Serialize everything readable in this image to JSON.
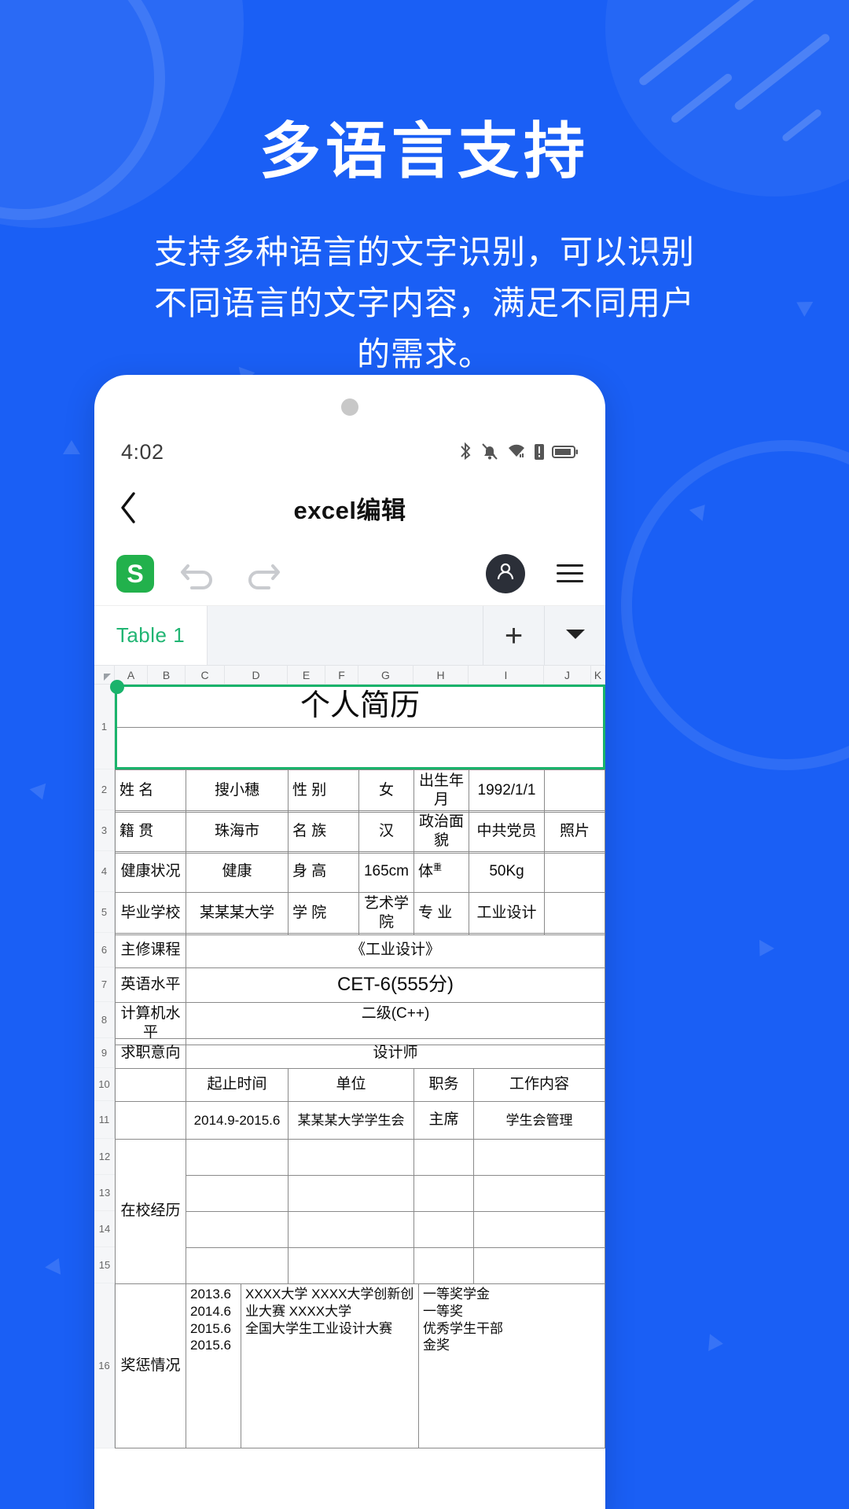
{
  "promo": {
    "title": "多语言支持",
    "subtitle": "支持多种语言的文字识别，可以识别不同语言的文字内容，满足不同用户的需求。",
    "accent_color": "#1A5FF5"
  },
  "phone": {
    "statusbar": {
      "time": "4:02",
      "icons": [
        "bluetooth-icon",
        "bell-muted-icon",
        "wifi-icon",
        "sim-alert-icon",
        "battery-icon"
      ]
    },
    "navbar": {
      "back_icon": "chevron-left-icon",
      "title": "excel编辑"
    },
    "toolbar": {
      "app_logo_letter": "S",
      "app_logo_color": "#22B14C",
      "undo_icon": "undo-icon",
      "redo_icon": "redo-icon",
      "avatar_icon": "user-avatar-icon",
      "menu_icon": "hamburger-menu-icon"
    },
    "sheettabs": {
      "active_tab": "Table 1",
      "add_label": "+",
      "dropdown_icon": "chevron-down-icon",
      "tab_color": "#21b573"
    },
    "grid": {
      "column_headers": [
        "A",
        "B",
        "C",
        "D",
        "E",
        "F",
        "G",
        "H",
        "I",
        "J",
        "K"
      ],
      "row_headers": [
        "1",
        "2",
        "3",
        "4",
        "5",
        "6",
        "7",
        "8",
        "9",
        "10",
        "11",
        "12",
        "13",
        "14",
        "15",
        "16"
      ],
      "selection_color": "#1ab36b"
    }
  },
  "resume": {
    "title": "个人简历",
    "rows": {
      "name_label": "姓    名",
      "name_value": "搜小穗",
      "gender_label": "性    别",
      "gender_value": "女",
      "birth_label": "出生年月",
      "birth_value": "1992/1/1",
      "photo_label": "照片",
      "native_label": "籍    贯",
      "native_value": "珠海市",
      "ethnic_label": "名    族",
      "ethnic_value": "汉",
      "political_label": "政治面貌",
      "political_value": "中共党员",
      "health_label": "健康状况",
      "health_value": "健康",
      "height_label": "身    高",
      "height_value": "165cm",
      "weight_label": "体",
      "weight_sup": "重",
      "weight_value": "50Kg",
      "school_label": "毕业学校",
      "school_value": "某某某大学",
      "college_label": "学    院",
      "college_value": "艺术学院",
      "major_label": "专    业",
      "major_value": "工业设计",
      "course_label": "主修课程",
      "course_value": "《工业设计》",
      "english_label": "英语水平",
      "english_value": "CET-6(555分)",
      "computer_label": "计算机水平",
      "computer_value": "二级(C++)",
      "intent_label": "求职意向",
      "intent_value": "设计师",
      "exp_label": "在校经历",
      "exp_head_time": "起止时间",
      "exp_head_org": "单位",
      "exp_head_role": "职务",
      "exp_head_content": "工作内容",
      "exp_time_1": "2014.9-2015.6",
      "exp_org_1": "某某某大学学生会",
      "exp_role_1": "主席",
      "exp_content_1": "学生会管理",
      "award_label": "奖惩情况",
      "award_dates": "2013.6\n2014.6\n2015.6\n2015.6",
      "award_events": "XXXX大学     XXXX大学创新创业大赛 XXXX大学\n全国大学生工业设计大赛",
      "award_results": "一等奖学金\n一等奖\n优秀学生干部\n金奖"
    }
  }
}
